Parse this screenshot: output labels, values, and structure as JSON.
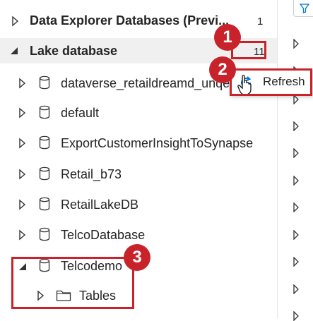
{
  "tree": {
    "data_explorer": {
      "label": "Data Explorer Databases (Previ...",
      "count": "1"
    },
    "lake_database": {
      "label": "Lake database",
      "count": "11"
    },
    "databases": [
      {
        "label": "dataverse_retaildreamd_unqe5"
      },
      {
        "label": "default"
      },
      {
        "label": "ExportCustomerInsightToSynapse"
      },
      {
        "label": "Retail_b73"
      },
      {
        "label": "RetailLakeDB"
      },
      {
        "label": "TelcoDatabase"
      },
      {
        "label": "Telcodemo"
      }
    ],
    "tables_folder": {
      "label": "Tables"
    }
  },
  "context_menu": {
    "refresh_label": "Refresh"
  },
  "callouts": [
    "1",
    "2",
    "3"
  ],
  "colors": {
    "callout": "#c8232a",
    "accent": "#0078d4"
  }
}
